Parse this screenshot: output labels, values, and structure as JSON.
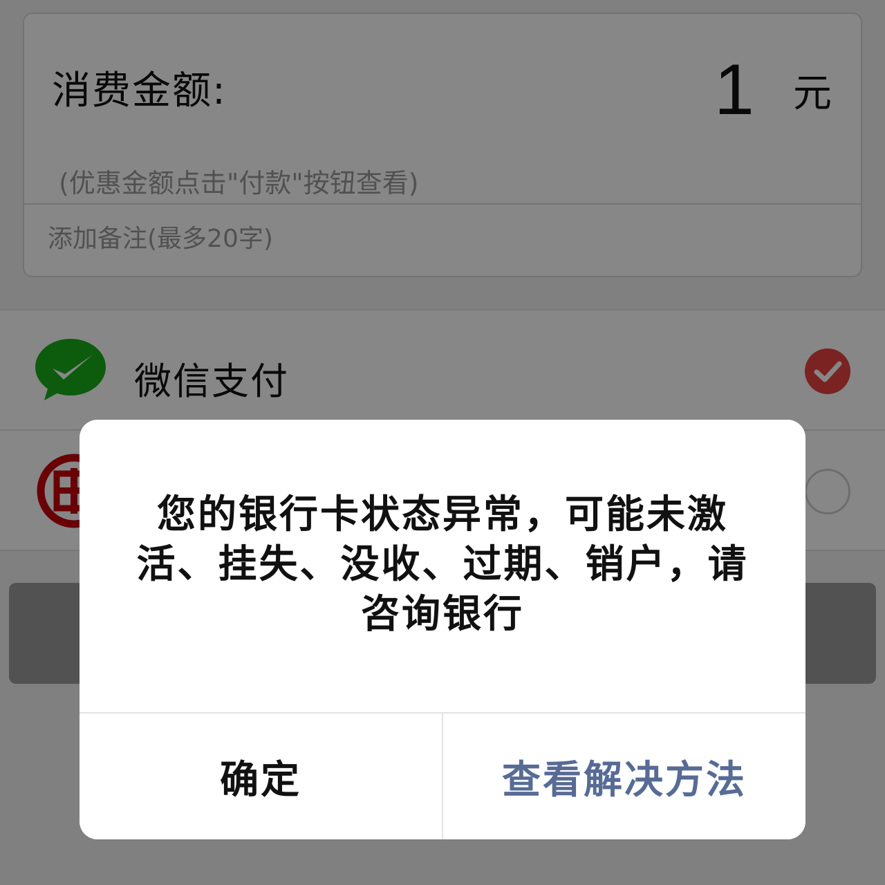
{
  "amount_card": {
    "label": "消费金额:",
    "value": "1",
    "unit": "元",
    "discount_hint": "(优惠金额点击\"付款\"按钮查看)",
    "remark_placeholder": "添加备注(最多20字)"
  },
  "payment_methods": [
    {
      "label": "微信支付",
      "icon": "wechat-pay-icon",
      "selected": true
    },
    {
      "label": "",
      "icon": "icbc-bank-icon",
      "selected": false
    }
  ],
  "pay_button": {
    "label": ""
  },
  "dialog": {
    "message": "您的银行卡状态异常，可能未激活、挂失、没收、过期、销户，请咨询银行",
    "confirm_label": "确定",
    "solution_label": "查看解决方法"
  },
  "colors": {
    "overlay": "#000000",
    "check_red": "#e64340",
    "wechat_green": "#1aad19",
    "link_blue": "#576b95",
    "icbc_red": "#c7000b"
  }
}
